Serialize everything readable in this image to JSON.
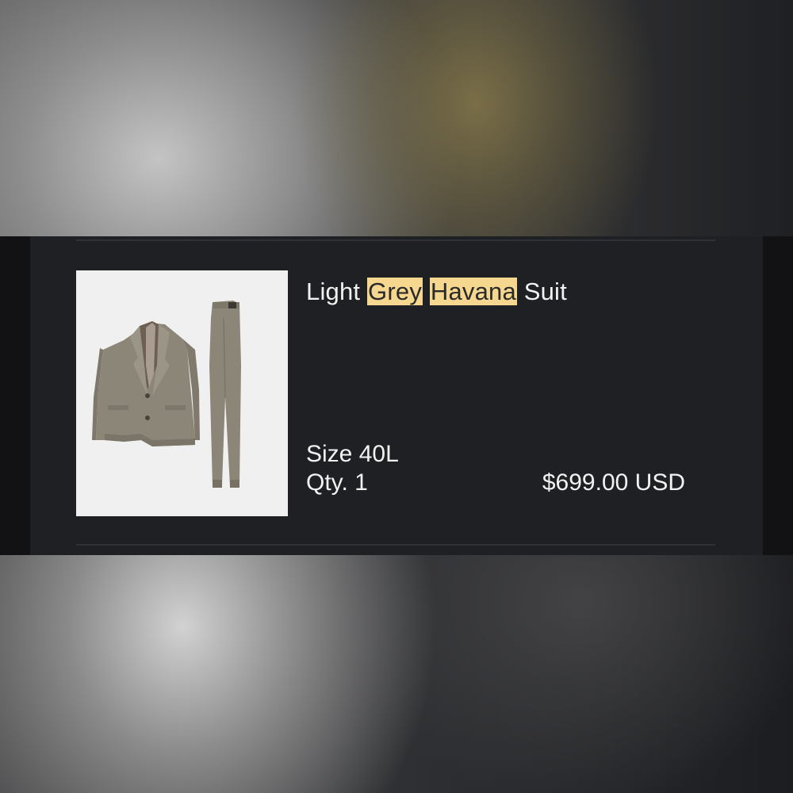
{
  "product": {
    "title_parts": {
      "before": "Light ",
      "highlight1": "Grey",
      "space": " ",
      "highlight2": "Havana",
      "after": " Suit"
    },
    "image_alt": "Light Grey Havana Suit jacket and trousers",
    "size": "Size 40L",
    "quantity": "Qty. 1",
    "price": "$699.00 USD"
  },
  "colors": {
    "card_background": "#1f2024",
    "highlight": "#f6d78f",
    "text": "#f2f2f2",
    "image_background": "#f0f0f0"
  }
}
